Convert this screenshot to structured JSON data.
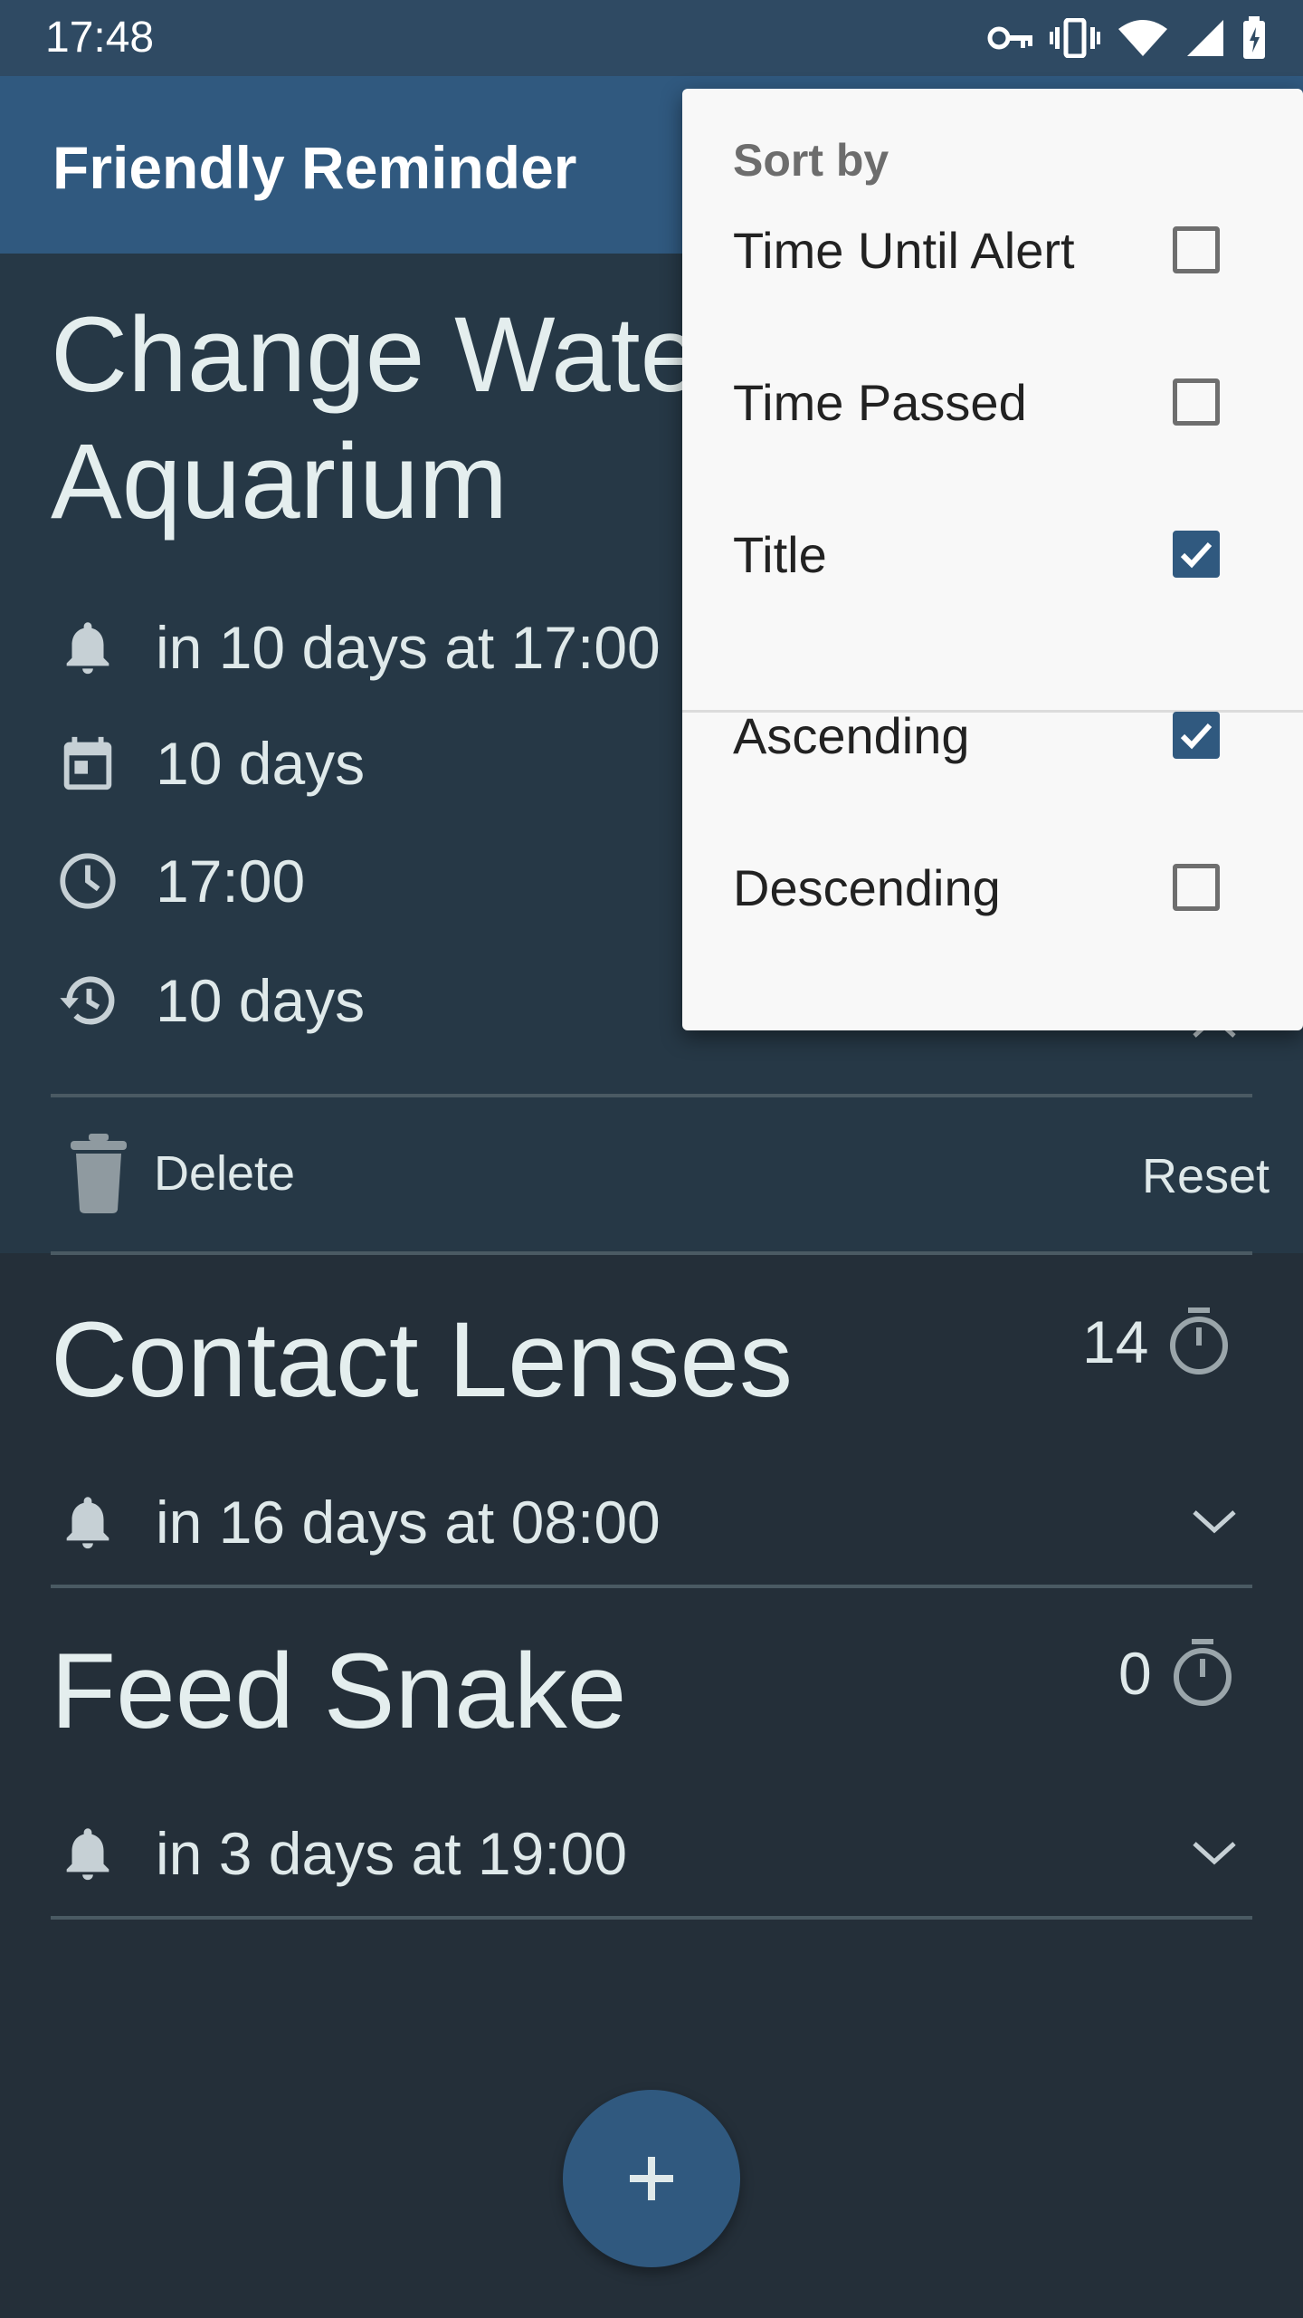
{
  "status_bar": {
    "time": "17:48"
  },
  "app_bar": {
    "title": "Friendly Reminder"
  },
  "reminders": [
    {
      "title": "Change Water\nAquarium",
      "alert": "in 10 days at 17:00",
      "interval": "10 days",
      "time": "17:00",
      "passed": "10 days",
      "delete_label": "Delete",
      "reset_label": "Reset"
    },
    {
      "title": "Contact Lenses",
      "count": "14",
      "alert": "in 16 days at 08:00"
    },
    {
      "title": "Feed Snake",
      "count": "0",
      "alert": "in 3 days at 19:00"
    }
  ],
  "sort_menu": {
    "header": "Sort by",
    "items": [
      {
        "label": "Time Until Alert",
        "checked": false
      },
      {
        "label": "Time Passed",
        "checked": false
      },
      {
        "label": "Title",
        "checked": true
      },
      {
        "label": "Ascending",
        "checked": true
      },
      {
        "label": "Descending",
        "checked": false
      }
    ]
  },
  "colors": {
    "accent": "#30597f",
    "background": "#242f39",
    "card": "#263846"
  },
  "icons": [
    "bell-icon",
    "calendar-icon",
    "clock-icon",
    "history-icon",
    "trash-icon",
    "timer-icon",
    "chevron-down-icon",
    "chevron-up-icon",
    "plus-icon"
  ]
}
